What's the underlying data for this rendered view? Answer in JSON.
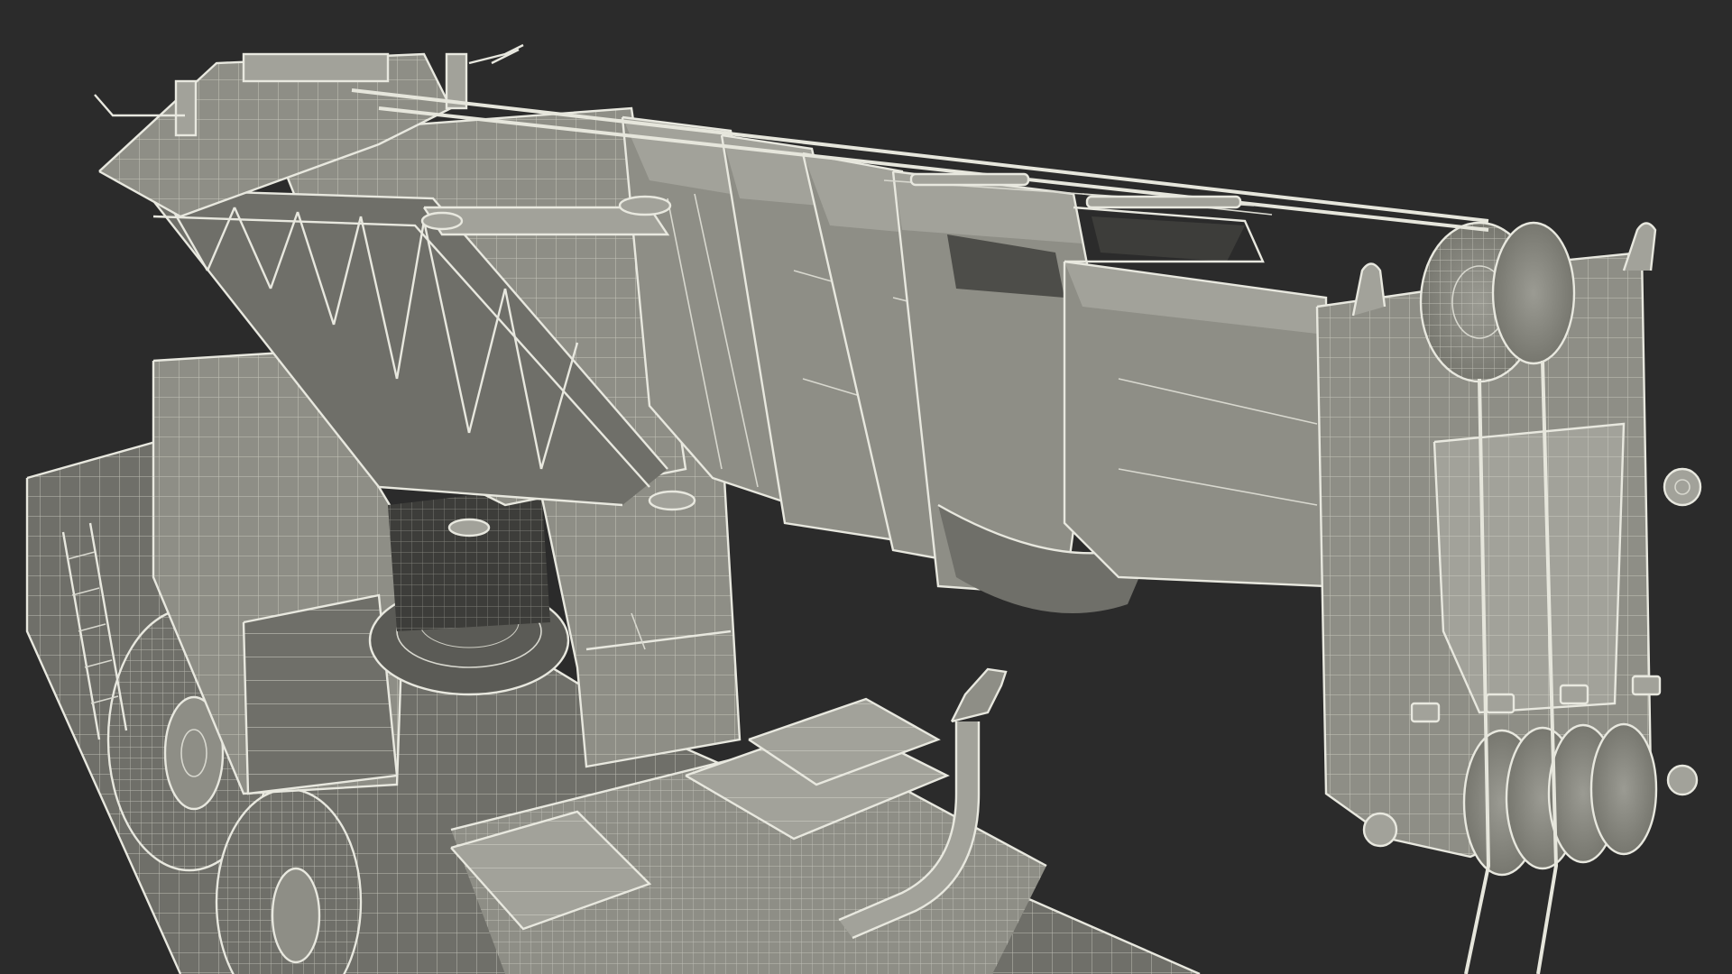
{
  "scene": {
    "subject": "mobile crane",
    "render_style": "wireframe over shaded model",
    "colors": {
      "background": "#2b2b2b",
      "model": "#8e8e86",
      "wire": "#d8d8cf"
    }
  }
}
